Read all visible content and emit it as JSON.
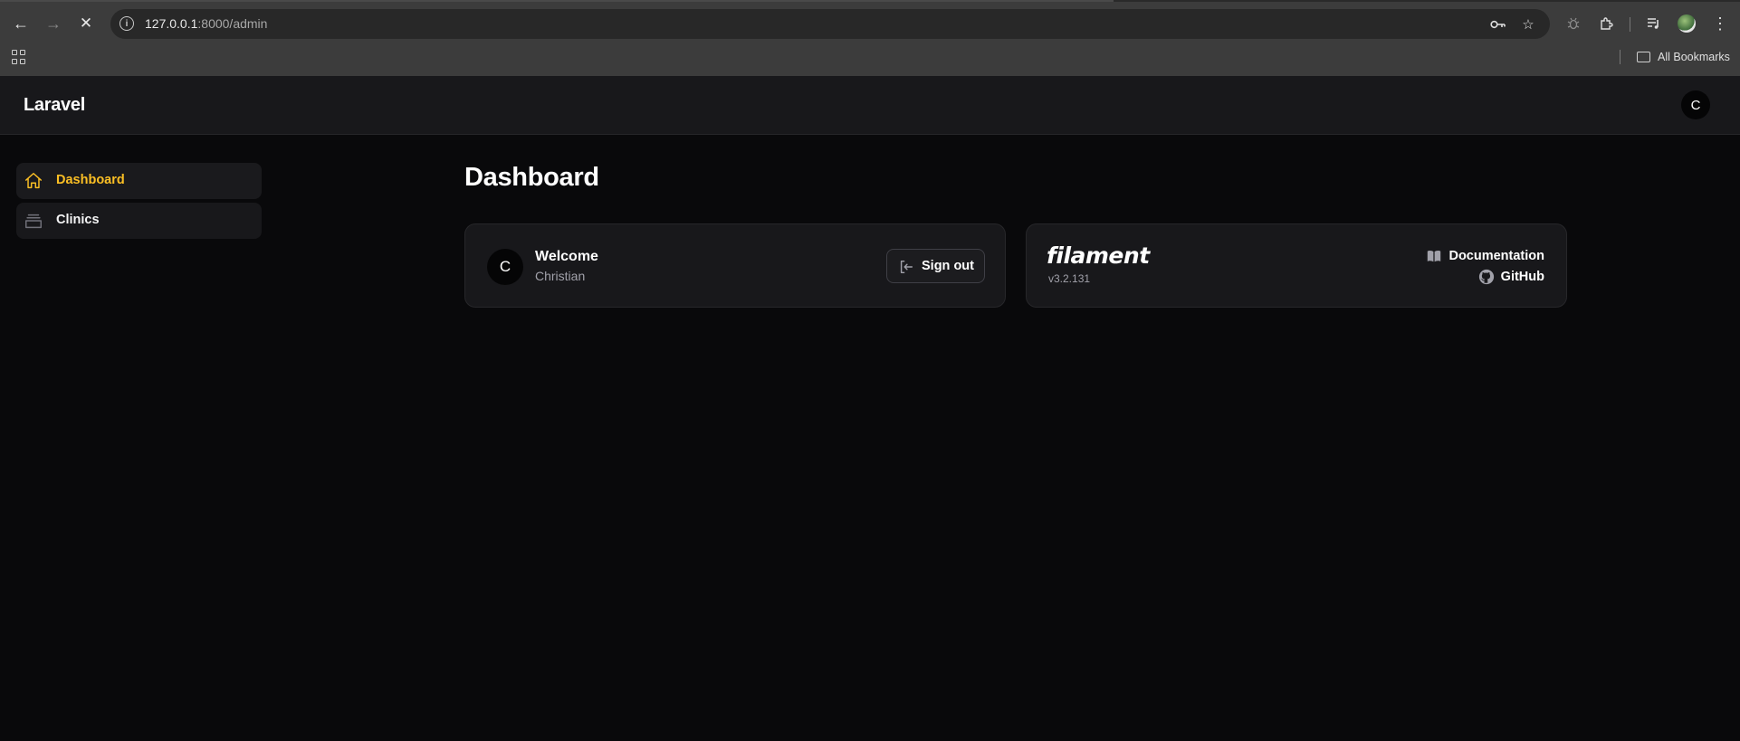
{
  "browser": {
    "url_host": "127.0.0.1",
    "url_port_path": ":8000/admin",
    "bookmarks_label": "All Bookmarks"
  },
  "app": {
    "brand": "Laravel",
    "user_initial": "C"
  },
  "sidebar": {
    "items": [
      {
        "label": "Dashboard",
        "icon": "home-icon",
        "active": true
      },
      {
        "label": "Clinics",
        "icon": "stack-icon",
        "active": false
      }
    ]
  },
  "main": {
    "title": "Dashboard",
    "welcome_card": {
      "avatar_initial": "C",
      "title": "Welcome",
      "name": "Christian",
      "signout_label": "Sign out"
    },
    "filament_card": {
      "logo": "filament",
      "version": "v3.2.131",
      "documentation_label": "Documentation",
      "github_label": "GitHub"
    }
  },
  "colors": {
    "accent": "#fbbf24",
    "background": "#09090b",
    "card": "#18181b"
  }
}
